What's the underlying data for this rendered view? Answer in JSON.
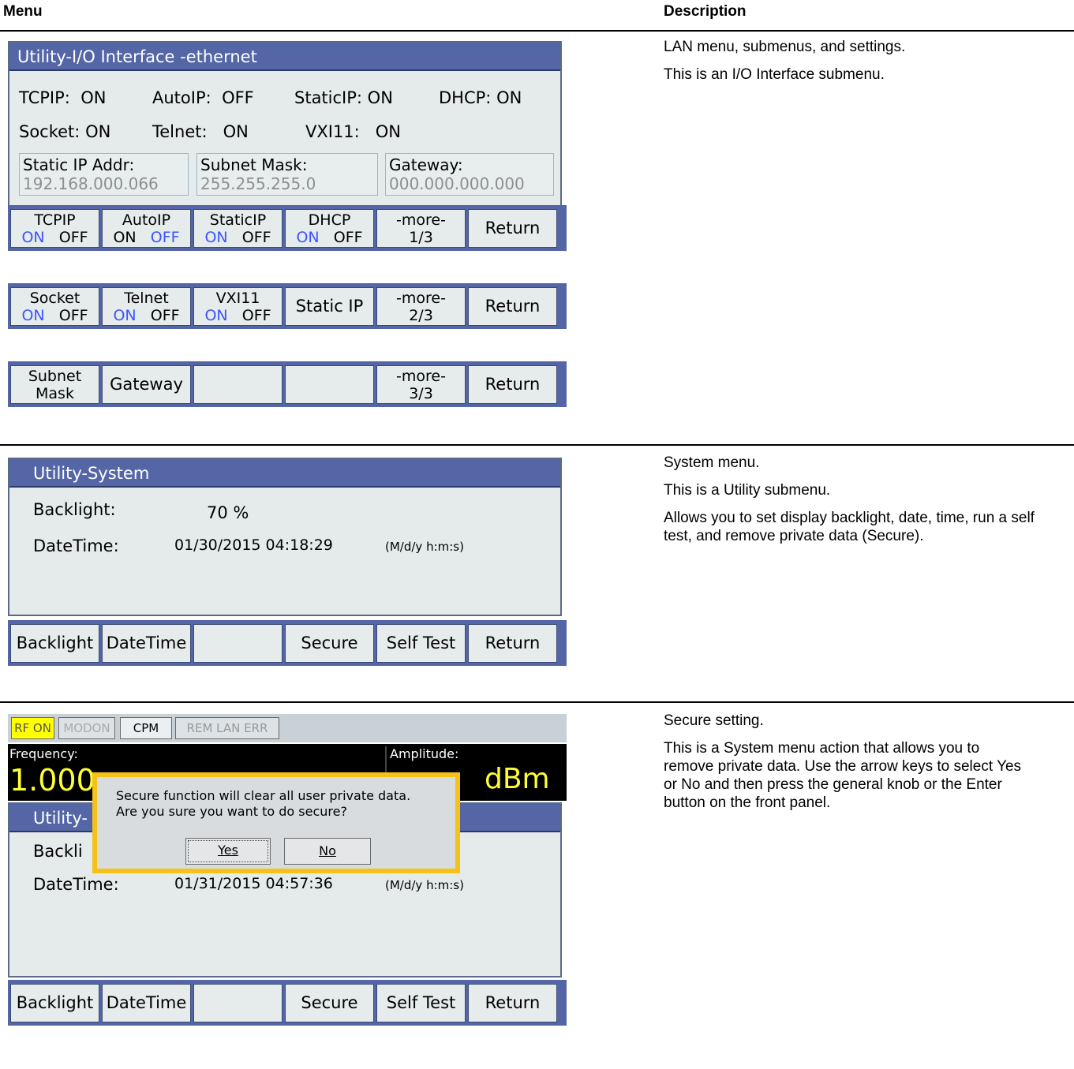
{
  "headers": {
    "menu": "Menu",
    "description": "Description"
  },
  "section1": {
    "panel_title": "Utility-I/O Interface -ethernet",
    "row1": [
      {
        "label": "TCPIP:",
        "value": "ON"
      },
      {
        "label": "AutoIP:",
        "value": "OFF"
      },
      {
        "label": "StaticIP:",
        "value": "ON"
      },
      {
        "label": "DHCP:",
        "value": "ON"
      }
    ],
    "row2": [
      {
        "label": "Socket:",
        "value": "ON"
      },
      {
        "label": "Telnet:",
        "value": "ON"
      },
      {
        "label": "VXI11:",
        "value": "ON"
      }
    ],
    "ip_boxes": [
      {
        "label": "Static IP Addr:",
        "value": "192.168.000.066"
      },
      {
        "label": "Subnet Mask:",
        "value": "255.255.255.0"
      },
      {
        "label": "Gateway:",
        "value": "000.000.000.000"
      }
    ],
    "softkeys_page1": [
      {
        "top": "TCPIP",
        "on": "ON",
        "off": "OFF",
        "active": "on"
      },
      {
        "top": "AutoIP",
        "on": "ON",
        "off": "OFF",
        "active": "off"
      },
      {
        "top": "StaticIP",
        "on": "ON",
        "off": "OFF",
        "active": "on"
      },
      {
        "top": "DHCP",
        "on": "ON",
        "off": "OFF",
        "active": "on"
      },
      {
        "top": "-more-",
        "bottom": "1/3"
      },
      {
        "single": "Return"
      }
    ],
    "softkeys_page2": [
      {
        "top": "Socket",
        "on": "ON",
        "off": "OFF",
        "active": "on"
      },
      {
        "top": "Telnet",
        "on": "ON",
        "off": "OFF",
        "active": "on"
      },
      {
        "top": "VXI11",
        "on": "ON",
        "off": "OFF",
        "active": "on"
      },
      {
        "single": "Static IP"
      },
      {
        "top": "-more-",
        "bottom": "2/3"
      },
      {
        "single": "Return"
      }
    ],
    "softkeys_page3": [
      {
        "top": "Subnet",
        "bottom": "Mask"
      },
      {
        "single": "Gateway"
      },
      {
        "single": ""
      },
      {
        "single": ""
      },
      {
        "top": "-more-",
        "bottom": "3/3"
      },
      {
        "single": "Return"
      }
    ],
    "description": [
      "LAN menu, submenus, and settings.",
      "This is an I/O Interface submenu."
    ]
  },
  "section2": {
    "panel_title": "Utility-System",
    "backlight_label": "Backlight:",
    "backlight_value": "70  %",
    "datetime_label": "DateTime:",
    "datetime_value": "01/30/2015 04:18:29",
    "datetime_format": "(M/d/y h:m:s)",
    "softkeys": [
      "Backlight",
      "DateTime",
      "",
      "Secure",
      "Self Test",
      "Return"
    ],
    "description": [
      "System menu.",
      "This is a Utility submenu.",
      "Allows you to set display backlight, date, time, run a self test, and remove private data (Secure)."
    ]
  },
  "section3": {
    "status_flags": [
      "RF ON",
      "MODON",
      "CPM",
      "REM LAN  ERR"
    ],
    "frequency_label": "Frequency:",
    "frequency_value": "1.000",
    "amplitude_label": "Amplitude:",
    "amplitude_unit": "dBm",
    "panel_title": "Utility-",
    "backlight_label": "Backli",
    "datetime_label": "DateTime:",
    "datetime_value": "01/31/2015 04:57:36",
    "datetime_format": "(M/d/y h:m:s)",
    "dialog": {
      "line1": "Secure function will clear all user private data.",
      "line2": "Are you sure you want to do secure?",
      "yes": "Yes",
      "no": "No"
    },
    "softkeys": [
      "Backlight",
      "DateTime",
      "",
      "Secure",
      "Self Test",
      "Return"
    ],
    "description": [
      "Secure setting.",
      "This is a System menu action that allows you to remove private data.  Use the arrow keys to select Yes or No and then press the general knob or the Enter button on the front panel."
    ]
  }
}
